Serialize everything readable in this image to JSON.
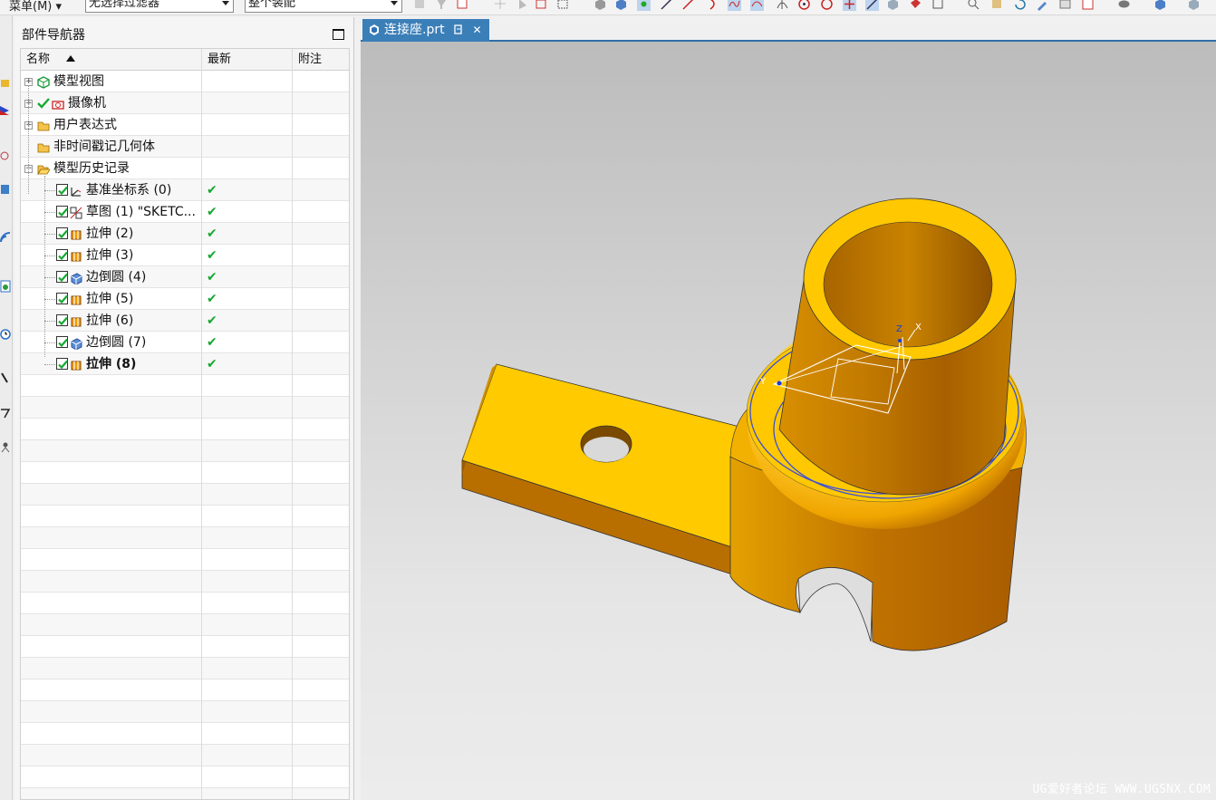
{
  "toolbar": {
    "menu_label": "菜单(M) ▾",
    "selection_filter": "无选择过滤器",
    "scope": "整个装配"
  },
  "part_navigator": {
    "title": "部件导航器",
    "columns": [
      "名称",
      "最新",
      "附注"
    ],
    "nodes": [
      {
        "label": "模型视图",
        "icon": "model-views-icon",
        "expand": "+",
        "latest": ""
      },
      {
        "label": "摄像机",
        "icon": "camera-icon",
        "expand": "+",
        "latest": ""
      },
      {
        "label": "用户表达式",
        "icon": "folder-icon",
        "expand": "+",
        "latest": ""
      },
      {
        "label": "非时间戳记几何体",
        "icon": "folder-icon",
        "expand": "",
        "latest": ""
      },
      {
        "label": "模型历史记录",
        "icon": "folder-open-icon",
        "expand": "-",
        "latest": ""
      },
      {
        "label": "基准坐标系 (0)",
        "icon": "datum-csys-icon",
        "checked": true,
        "latest": "✔"
      },
      {
        "label": "草图 (1) \"SKETC...",
        "icon": "sketch-icon",
        "checked": true,
        "latest": "✔"
      },
      {
        "label": "拉伸 (2)",
        "icon": "extrude-icon",
        "checked": true,
        "latest": "✔"
      },
      {
        "label": "拉伸 (3)",
        "icon": "extrude-icon",
        "checked": true,
        "latest": "✔"
      },
      {
        "label": "边倒圆 (4)",
        "icon": "edge-blend-icon",
        "checked": true,
        "latest": "✔"
      },
      {
        "label": "拉伸 (5)",
        "icon": "extrude-icon",
        "checked": true,
        "latest": "✔"
      },
      {
        "label": "拉伸 (6)",
        "icon": "extrude-icon",
        "checked": true,
        "latest": "✔"
      },
      {
        "label": "边倒圆 (7)",
        "icon": "edge-blend-icon",
        "checked": true,
        "latest": "✔"
      },
      {
        "label": "拉伸 (8)",
        "icon": "extrude-icon",
        "checked": true,
        "latest": "✔",
        "bold": true
      }
    ]
  },
  "tab": {
    "title": "连接座.prt",
    "close": "✕"
  },
  "viewport": {
    "axis_labels": {
      "x": "X",
      "y": "Y",
      "z": "Z"
    },
    "watermark": "UG爱好者论坛 WWW.UGSNX.COM",
    "colors": {
      "part_face": "#f9c400",
      "part_shadow": "#c27800",
      "selection_edge": "#3b4fd8"
    }
  }
}
